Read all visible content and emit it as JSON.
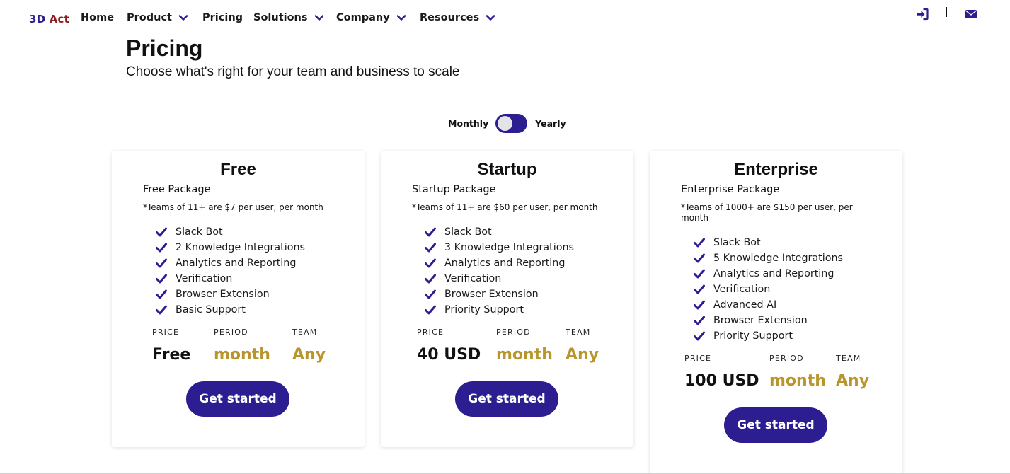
{
  "brand": {
    "part1": "3D",
    "part2": "Act"
  },
  "nav": {
    "home": "Home",
    "product": "Product",
    "pricing": "Pricing",
    "solutions": "Solutions",
    "company": "Company",
    "resources": "Resources",
    "icons": [
      "sign-in-icon",
      "envelope-icon"
    ]
  },
  "header": {
    "title": "Pricing",
    "subtitle": "Choose what's right for your team and business to scale"
  },
  "billing_toggle": {
    "left": "Monthly",
    "right": "Yearly",
    "selected": "Monthly"
  },
  "colors": {
    "primary": "#2c1e91",
    "gold": "#b8962d",
    "brand_red": "#8c1c1c"
  },
  "plans": [
    {
      "name": "Free",
      "package": "Free Package",
      "note": "*Teams of 11+ are $7 per user, per month",
      "features": [
        "Slack Bot",
        "2 Knowledge Integrations",
        "Analytics and Reporting",
        "Verification",
        "Browser Extension",
        "Basic Support"
      ],
      "price_label": "PRICE",
      "period_label": "PERIOD",
      "team_label": "TEAM",
      "price": "Free",
      "period": "month",
      "team": "Any",
      "cta": "Get started"
    },
    {
      "name": "Startup",
      "package": "Startup Package",
      "note": "*Teams of 11+ are $60 per user, per month",
      "features": [
        "Slack Bot",
        "3 Knowledge Integrations",
        "Analytics and Reporting",
        "Verification",
        "Browser Extension",
        "Priority Support"
      ],
      "price_label": "PRICE",
      "period_label": "PERIOD",
      "team_label": "TEAM",
      "price": "40 USD",
      "period": "month",
      "team": "Any",
      "cta": "Get started"
    },
    {
      "name": "Enterprise",
      "package": "Enterprise Package",
      "note": "*Teams of 1000+ are $150 per user, per month",
      "features": [
        "Slack Bot",
        "5 Knowledge Integrations",
        "Analytics and Reporting",
        "Verification",
        "Advanced AI",
        "Browser Extension",
        "Priority Support"
      ],
      "price_label": "PRICE",
      "period_label": "PERIOD",
      "team_label": "TEAM",
      "price": "100 USD",
      "period": "month",
      "team": "Any",
      "cta": "Get started"
    }
  ]
}
